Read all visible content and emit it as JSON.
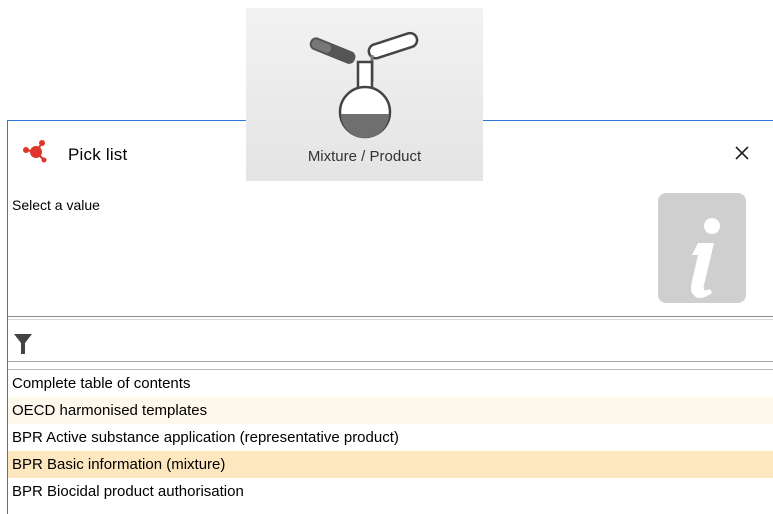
{
  "tile": {
    "label": "Mixture / Product",
    "icon": "flask-pouring-icon"
  },
  "dialog": {
    "title": "Pick list",
    "app_icon": "molecule-icon",
    "close_icon": "close-icon",
    "prompt": "Select a value",
    "info_icon": "info-icon",
    "filter": {
      "icon": "filter-funnel-icon",
      "value": "",
      "placeholder": ""
    },
    "items": [
      {
        "label": "Complete table of contents",
        "state": "normal"
      },
      {
        "label": "OECD harmonised templates",
        "state": "alt"
      },
      {
        "label": "BPR Active substance application (representative product)",
        "state": "normal"
      },
      {
        "label": "BPR Basic information (mixture)",
        "state": "selected"
      },
      {
        "label": "BPR Biocidal product authorisation",
        "state": "normal"
      }
    ]
  },
  "colors": {
    "window_border": "#2b79d6",
    "selected_row": "#fde7bf",
    "alt_row": "#fdf7ec",
    "accent_red": "#e0352b"
  }
}
